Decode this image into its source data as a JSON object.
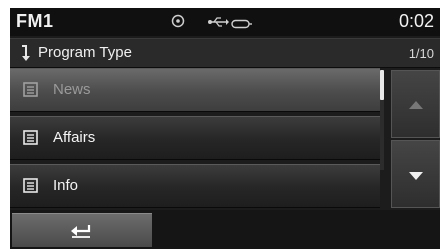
{
  "status": {
    "band": "FM1",
    "time": "0:02",
    "icons": [
      "disc-icon",
      "usb-icon",
      "aux-icon"
    ]
  },
  "header": {
    "title": "Program Type",
    "page": "1/10",
    "icon": "return-arrow-icon"
  },
  "list": {
    "items": [
      {
        "label": "News",
        "selected": true
      },
      {
        "label": "Affairs",
        "selected": false
      },
      {
        "label": "Info",
        "selected": false
      }
    ]
  },
  "controls": {
    "scroll_up_icon": "triangle-up-icon",
    "scroll_down_icon": "triangle-down-icon",
    "back_icon": "back-icon"
  }
}
